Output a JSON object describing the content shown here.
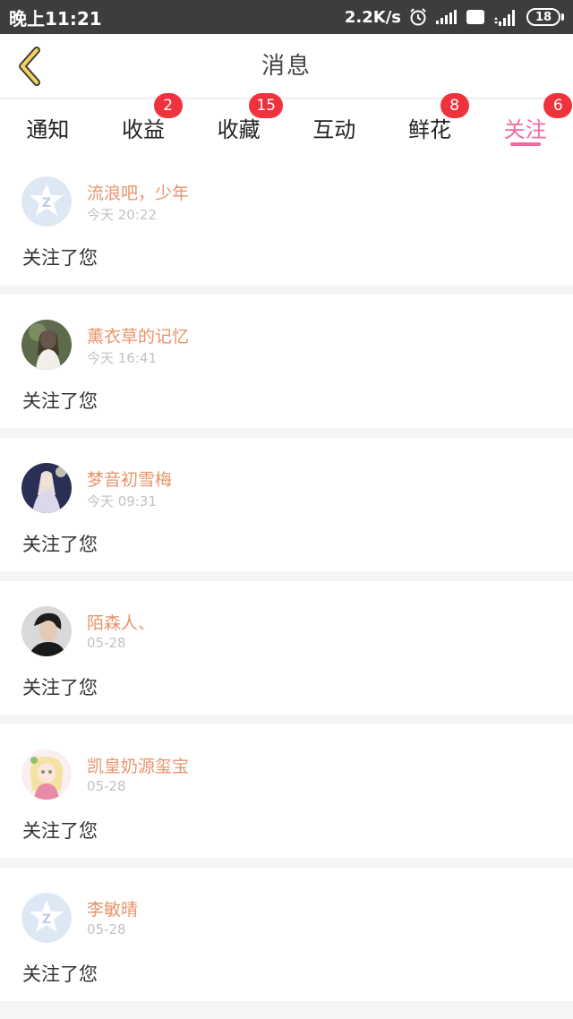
{
  "status_bar": {
    "time": "晚上11:21",
    "speed": "2.2K/s",
    "hd": "HD",
    "net_type": "4G",
    "battery": "18"
  },
  "header": {
    "title": "消息"
  },
  "tabs": [
    {
      "label": "通知",
      "badge": null,
      "active": false
    },
    {
      "label": "收益",
      "badge": "2",
      "active": false
    },
    {
      "label": "收藏",
      "badge": "15",
      "active": false
    },
    {
      "label": "互动",
      "badge": null,
      "active": false
    },
    {
      "label": "鲜花",
      "badge": "8",
      "active": false
    },
    {
      "label": "关注",
      "badge": "6",
      "active": true
    }
  ],
  "messages": [
    {
      "name": "流浪吧，少年",
      "time": "今天 20:22",
      "text": "关注了您",
      "avatar": "default-avatar"
    },
    {
      "name": "薰衣草的记忆",
      "time": "今天 16:41",
      "text": "关注了您",
      "avatar": "photo-avatar"
    },
    {
      "name": "梦音初雪梅",
      "time": "今天 09:31",
      "text": "关注了您",
      "avatar": "photo-avatar"
    },
    {
      "name": "陌森人、",
      "time": "05-28",
      "text": "关注了您",
      "avatar": "photo-avatar"
    },
    {
      "name": "凯皇奶源玺宝",
      "time": "05-28",
      "text": "关注了您",
      "avatar": "photo-avatar"
    },
    {
      "name": "李敏晴",
      "time": "05-28",
      "text": "关注了您",
      "avatar": "default-avatar"
    }
  ],
  "colors": {
    "accent": "#f06ca0",
    "badge": "#f0323c",
    "name": "#e8946a",
    "back_arrow": "#f3d35a"
  }
}
